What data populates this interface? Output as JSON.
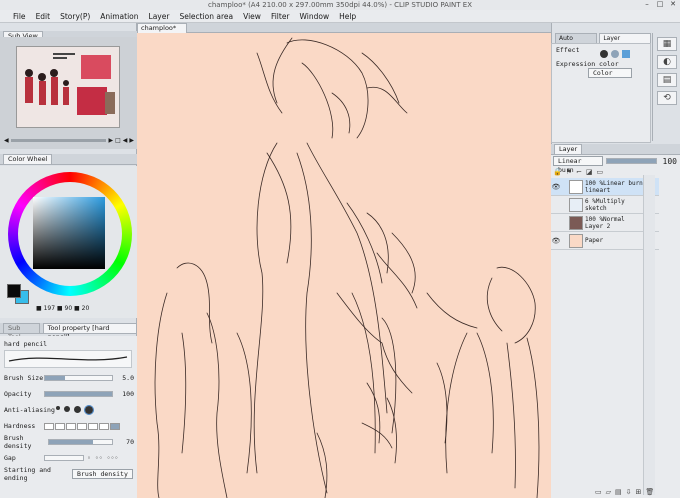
{
  "window": {
    "title": "champloo* (A4 210.00 x 297.00mm 350dpi 44.0%) - CLIP STUDIO PAINT EX",
    "controls": [
      "–",
      "□",
      "✕"
    ]
  },
  "menu": [
    "File",
    "Edit",
    "Story(P)",
    "Animation",
    "Layer",
    "Selection area",
    "View",
    "Filter",
    "Window",
    "Help"
  ],
  "subview": {
    "tab": "Sub View"
  },
  "color_wheel": {
    "tab": "Color Wheel",
    "main_color": "#0a0a0a",
    "sub_color": "#37bdea",
    "readout": "■ 197 ■ 90 ■ 20"
  },
  "tool_property": {
    "tabs": [
      "Sub Tool",
      "Tool property [hard pencil]"
    ],
    "tool_name": "hard pencil",
    "brush_size": {
      "label": "Brush Size",
      "value": "5.0",
      "percent": 30
    },
    "opacity": {
      "label": "Opacity",
      "value": "100",
      "percent": 100
    },
    "anti_aliasing": {
      "label": "Anti-aliasing"
    },
    "hardness": {
      "label": "Hardness"
    },
    "brush_density": {
      "label": "Brush density",
      "value": "70",
      "percent": 70
    },
    "gap": {
      "label": "Gap"
    },
    "starting_ending": {
      "label": "Starting and ending",
      "value": "Brush density"
    }
  },
  "document": {
    "tab": "champloo*",
    "canvas_color": "#fad9c6"
  },
  "right_tabs": [
    "Auto Action",
    "Layer Property"
  ],
  "layer_property": {
    "effect_label": "Effect",
    "expression_color_label": "Expression color",
    "expression_color_value": "Color"
  },
  "layer_panel": {
    "tab": "Layer",
    "blend_mode": "Linear burn",
    "opacity": "100",
    "layers": [
      {
        "line1": "100 %Linear burn",
        "line2": "lineart",
        "selected": true,
        "visible": true
      },
      {
        "line1": "6 %Multiply",
        "line2": "sketch",
        "selected": false,
        "visible": false
      },
      {
        "line1": "100 %Normal",
        "line2": "Layer 2",
        "selected": false,
        "visible": false
      },
      {
        "line1": "Paper",
        "line2": "",
        "selected": false,
        "visible": true
      }
    ]
  }
}
